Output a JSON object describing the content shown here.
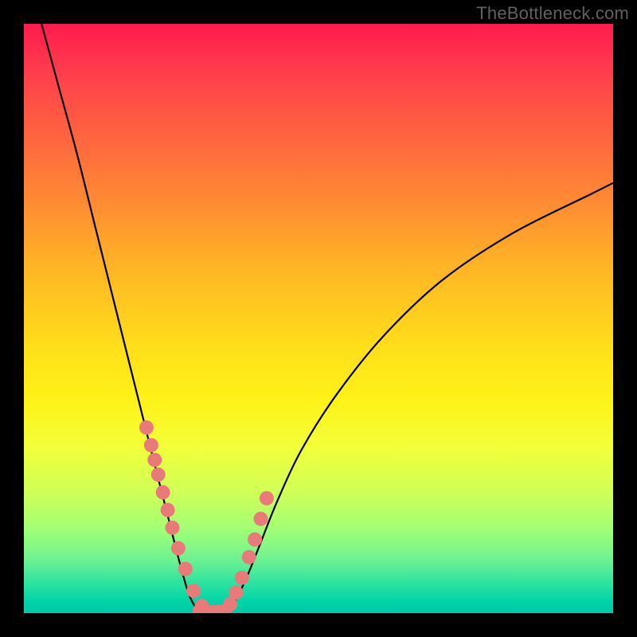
{
  "watermark": "TheBottleneck.com",
  "colors": {
    "dot": "#e97a7a",
    "curve": "#000000",
    "frame": "#000000"
  },
  "chart_data": {
    "type": "line",
    "title": "",
    "xlabel": "",
    "ylabel": "",
    "xlim": [
      0,
      100
    ],
    "ylim": [
      0,
      100
    ],
    "grid": false,
    "legend": false,
    "curve_left": {
      "name": "bottleneck-left",
      "x": [
        3,
        6,
        9,
        12,
        15,
        18,
        20.5,
        22.5,
        24.3,
        25.8,
        27.0,
        28.0,
        29.0,
        30.0,
        31.0
      ],
      "y": [
        100,
        89,
        78,
        66,
        54,
        42,
        32,
        24,
        17,
        11,
        6.5,
        3.2,
        1.2,
        0.2,
        0
      ]
    },
    "curve_right": {
      "name": "bottleneck-right",
      "x": [
        34.0,
        35.2,
        36.6,
        38.2,
        40.2,
        43.0,
        47.0,
        53.0,
        61.0,
        71.0,
        83.0,
        96.0,
        100.0
      ],
      "y": [
        0,
        1.2,
        3.5,
        7,
        12,
        19,
        27.5,
        37,
        47,
        56.5,
        64.5,
        71,
        73
      ]
    },
    "dots_left": {
      "name": "samples-left",
      "x": [
        20.8,
        21.6,
        22.2,
        22.8,
        23.6,
        24.4,
        25.2,
        26.2,
        27.4,
        28.8,
        30.2,
        31.0,
        31.8,
        32.4
      ],
      "y": [
        31.5,
        28.5,
        26.0,
        23.5,
        20.5,
        17.5,
        14.5,
        11.0,
        7.5,
        3.8,
        1.2,
        0.2,
        0,
        0
      ]
    },
    "dots_right": {
      "name": "samples-right",
      "x": [
        33.2,
        34.0,
        35.0,
        36.0,
        37.0,
        38.2,
        39.2,
        40.2,
        41.2
      ],
      "y": [
        0,
        0.3,
        1.5,
        3.5,
        6.0,
        9.5,
        12.5,
        16.0,
        19.5
      ]
    },
    "dots_floor": {
      "name": "floor-cluster",
      "x": [
        29.8,
        30.6,
        31.4,
        32.2,
        33.0,
        33.8
      ],
      "y": [
        0.3,
        0.2,
        0.15,
        0.15,
        0.2,
        0.3
      ]
    }
  }
}
